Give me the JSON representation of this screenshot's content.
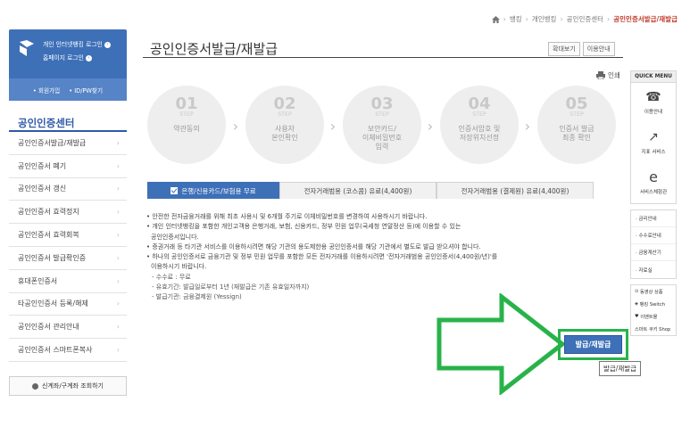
{
  "breadcrumb": [
    "뱅킹",
    "개인뱅킹",
    "공인인증센터",
    "공인인증서발급/재발급"
  ],
  "login": {
    "line1": "개인 인터넷뱅킹 로그인",
    "line2": "홈페이지 로그인",
    "link1": "회원가입",
    "link2": "ID/PW찾기"
  },
  "sidebar": {
    "title": "공인인증센터",
    "items": [
      {
        "label": "공인인증서발급/재발급"
      },
      {
        "label": "공인인증서 폐기"
      },
      {
        "label": "공인인증서 갱신"
      },
      {
        "label": "공인인증서 효력정지"
      },
      {
        "label": "공인인증서 효력회복"
      },
      {
        "label": "공인인증서 발급확인증"
      },
      {
        "label": "휴대폰인증서"
      },
      {
        "label": "타공인인증서 등록/해제"
      },
      {
        "label": "공인인증서 관리안내"
      },
      {
        "label": "공인인증서 스마트폰복사"
      }
    ],
    "lookup": "신계좌/구계좌 조회하기"
  },
  "page": {
    "title": "공인인증서발급/재발급",
    "zoom_btn": "확대보기",
    "guide_btn": "이용안내",
    "print": "인쇄"
  },
  "steps": [
    {
      "num": "01",
      "step": "STEP",
      "name": "약관동의"
    },
    {
      "num": "02",
      "step": "STEP",
      "name": "사용자\n본인확인"
    },
    {
      "num": "03",
      "step": "STEP",
      "name": "보안카드/\n이체비밀번호\n입력"
    },
    {
      "num": "04",
      "step": "STEP",
      "name": "인증서암호 및\n저장위치선정"
    },
    {
      "num": "05",
      "step": "STEP",
      "name": "인증서 발급\n최종 확인"
    }
  ],
  "tabs": [
    {
      "label": "은행/신용카드/보험용 무료"
    },
    {
      "label": "전자거래범용 (코스콤) 유료(4,400원)"
    },
    {
      "label": "전자거래범용 (결제원) 유료(4,400원)"
    }
  ],
  "notes": [
    "• 안전한 전자금융거래를 위해 최초 사용시 및 6개월 주기로 이체비밀번호를 변경하여 사용하시기 바랍니다.",
    "• 개인 인터넷뱅킹을 포함한 개인고객용 은행거래, 보험, 신용카드, 정부 민원 업무(국세청 연말정산 등)에 이용할 수 있는",
    "공인인증서입니다.",
    "• 증권거래 등 타기관 서비스를 이용하시려면 해당 기관의 용도제한용 공인인증서를 해당 기관에서 별도로 발급 받으셔야 합니다.",
    "• 하나의 공인인증서로 금융기관 및 정부 민원 업무를 포함한 모든 전자거래를 이용하시려면 '전자거래범용 공인인증서(4,400원/년)'를",
    "이용하시기 바랍니다."
  ],
  "details": [
    "- 수수료 : 무료",
    "- 유효기간: 발급일로부터 1년 (재발급은 기존 유효일자까지)",
    "- 발급기관: 금융결제원 (Yessign)"
  ],
  "action": {
    "issue_btn": "발급/재발급",
    "tooltip": "발급/재발급"
  },
  "quick_menu": {
    "title": "QUICK MENU",
    "items": [
      "이용안내",
      "지표 서비스",
      "서비스체험관"
    ],
    "list": [
      "· 금리안내",
      "· 수수료안내",
      "· 금융계산기",
      "· 자료실"
    ],
    "list2": [
      "동영상 상품",
      "뱅킹 Switch",
      "이벤트몰",
      "스마트 쿠키 Shop"
    ]
  },
  "colors": {
    "primary": "#3e70b8",
    "highlight": "#28b34a",
    "current": "#c0392b"
  }
}
